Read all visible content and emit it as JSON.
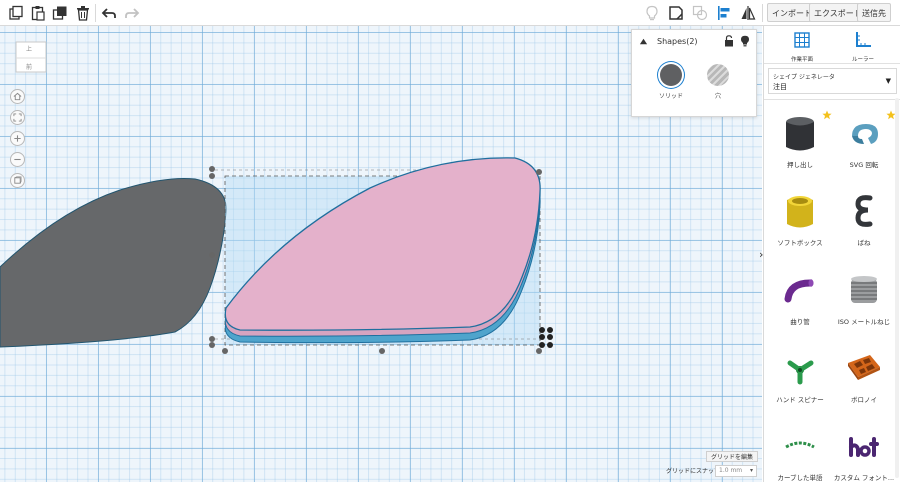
{
  "toolbar": {
    "left_icons": [
      {
        "name": "copy-icon"
      },
      {
        "name": "paste-icon"
      },
      {
        "name": "duplicate-icon"
      },
      {
        "name": "trash-icon"
      },
      {
        "name": "undo-icon"
      },
      {
        "name": "redo-icon"
      }
    ],
    "right_icons": [
      {
        "name": "lightbulb-icon"
      },
      {
        "name": "note-icon"
      },
      {
        "name": "group-icon"
      },
      {
        "name": "align-icon"
      },
      {
        "name": "mirror-icon"
      }
    ],
    "import_label": "インポート",
    "export_label": "エクスポート",
    "send_label": "送信先"
  },
  "viewcube": {
    "top_label": "上",
    "front_label": "前"
  },
  "nav": [
    {
      "name": "home-icon"
    },
    {
      "name": "fit-icon"
    },
    {
      "name": "zoom-in-icon"
    },
    {
      "name": "zoom-out-icon"
    },
    {
      "name": "ortho-icon"
    }
  ],
  "shapes_panel": {
    "title": "Shapes(2)",
    "solid_label": "ソリッド",
    "hole_label": "穴",
    "solid_color": "#5f6062",
    "hole_color": "#b8b8b8"
  },
  "grid": {
    "edit_label": "グリッドを編集",
    "snap_label": "グリッドにスナップ",
    "snap_value": "1.0 mm"
  },
  "right_panel": {
    "workplane_label": "作業平面",
    "ruler_label": "ルーラー",
    "generator_label": "シェイプ ジェネレータ",
    "generator_value": "注目",
    "shapes": [
      {
        "label": "押し出し",
        "icon": "extrusion-icon",
        "star": true
      },
      {
        "label": "SVG 回転",
        "icon": "svg-revolve-icon",
        "star": true
      },
      {
        "label": "ソフトボックス",
        "icon": "soft-box-icon",
        "star": false
      },
      {
        "label": "ばね",
        "icon": "spring-icon",
        "star": false
      },
      {
        "label": "曲り管",
        "icon": "bent-pipe-icon",
        "star": false
      },
      {
        "label": "ISO メートルねじ",
        "icon": "iso-screw-icon",
        "star": false
      },
      {
        "label": "ハンド スピナー",
        "icon": "hand-spinner-icon",
        "star": false
      },
      {
        "label": "ボロノイ",
        "icon": "voronoi-icon",
        "star": false
      },
      {
        "label": "カーブした単語",
        "icon": "curved-word-icon",
        "star": false
      },
      {
        "label": "カスタム フォント...",
        "icon": "custom-font-icon",
        "star": false
      }
    ]
  },
  "colors": {
    "accent": "#1c7fcf",
    "shape_pink": "#e4b1cb",
    "shape_outline": "#1f6f9e",
    "shape_gray": "#66686a"
  }
}
